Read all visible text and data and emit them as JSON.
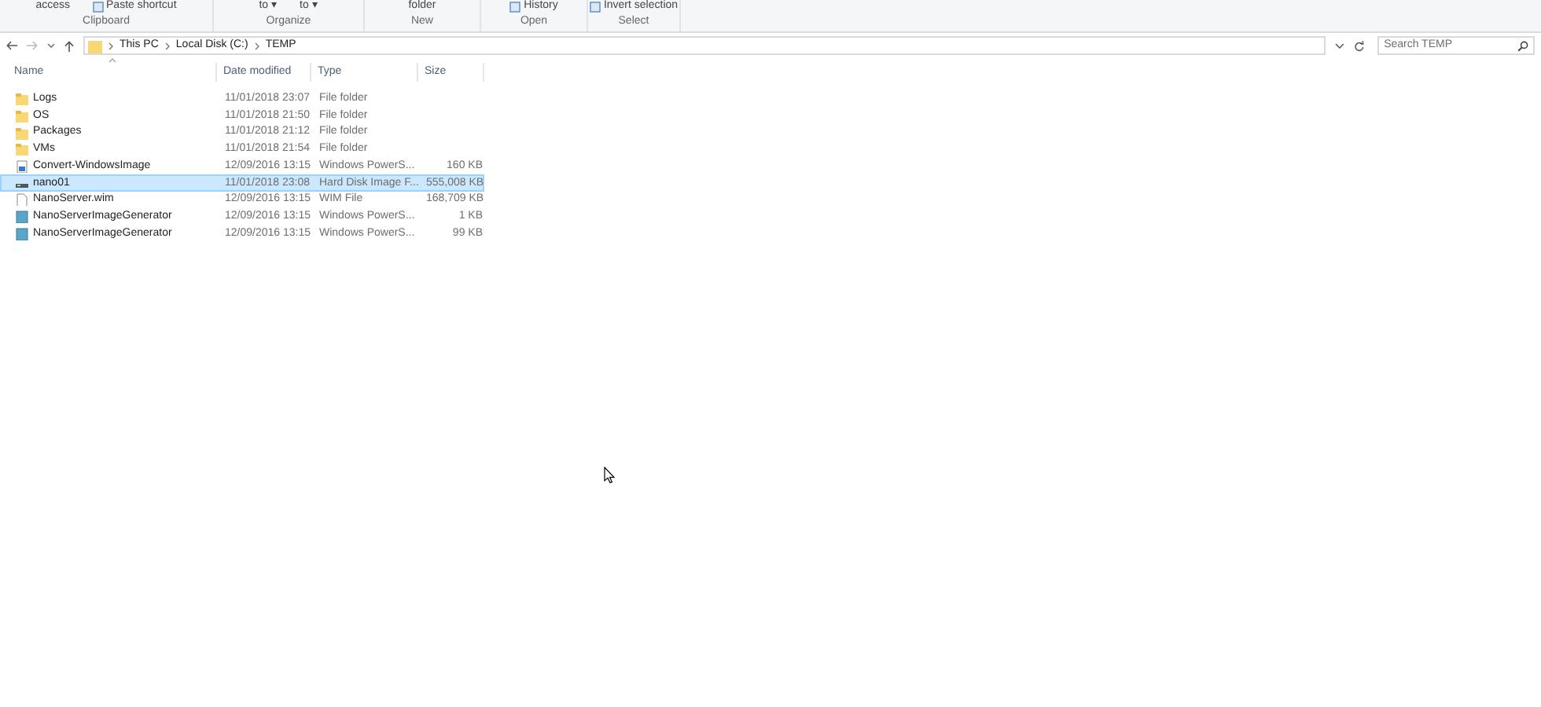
{
  "ribbon": {
    "groups": [
      {
        "label": "Clipboard",
        "items": [
          {
            "text": "access",
            "icon": false
          },
          {
            "text": "Paste shortcut",
            "icon": true
          }
        ]
      },
      {
        "label": "Organize",
        "items": [
          {
            "text": "to ▾",
            "icon": false
          },
          {
            "text": "to ▾",
            "icon": false
          }
        ]
      },
      {
        "label": "New",
        "items": [
          {
            "text": "folder",
            "icon": false
          }
        ]
      },
      {
        "label": "Open",
        "items": [
          {
            "text": "History",
            "icon": true
          }
        ]
      },
      {
        "label": "Select",
        "items": [
          {
            "text": "Invert selection",
            "icon": true
          }
        ]
      }
    ]
  },
  "address": {
    "path": [
      "This PC",
      "Local Disk (C:)",
      "TEMP"
    ]
  },
  "search": {
    "placeholder": "Search TEMP"
  },
  "table": {
    "columns": [
      "Name",
      "Date modified",
      "Type",
      "Size"
    ],
    "rows": [
      {
        "kind": "folder",
        "name": "Logs",
        "date": "11/01/2018 23:07",
        "type": "File folder",
        "size": "",
        "selected": false
      },
      {
        "kind": "folder",
        "name": "OS",
        "date": "11/01/2018 21:50",
        "type": "File folder",
        "size": "",
        "selected": false
      },
      {
        "kind": "folder",
        "name": "Packages",
        "date": "11/01/2018 21:12",
        "type": "File folder",
        "size": "",
        "selected": false
      },
      {
        "kind": "folder",
        "name": "VMs",
        "date": "11/01/2018 21:54",
        "type": "File folder",
        "size": "",
        "selected": false
      },
      {
        "kind": "script",
        "name": "Convert-WindowsImage",
        "date": "12/09/2016 13:15",
        "type": "Windows PowerS...",
        "size": "160 KB",
        "selected": false
      },
      {
        "kind": "disk",
        "name": "nano01",
        "date": "11/01/2018 23:08",
        "type": "Hard Disk Image F...",
        "size": "555,008 KB",
        "selected": true
      },
      {
        "kind": "file",
        "name": "NanoServer.wim",
        "date": "12/09/2016 13:15",
        "type": "WIM File",
        "size": "168,709 KB",
        "selected": false
      },
      {
        "kind": "script2",
        "name": "NanoServerImageGenerator",
        "date": "12/09/2016 13:15",
        "type": "Windows PowerS...",
        "size": "1 KB",
        "selected": false
      },
      {
        "kind": "script2",
        "name": "NanoServerImageGenerator",
        "date": "12/09/2016 13:15",
        "type": "Windows PowerS...",
        "size": "99 KB",
        "selected": false
      }
    ]
  }
}
